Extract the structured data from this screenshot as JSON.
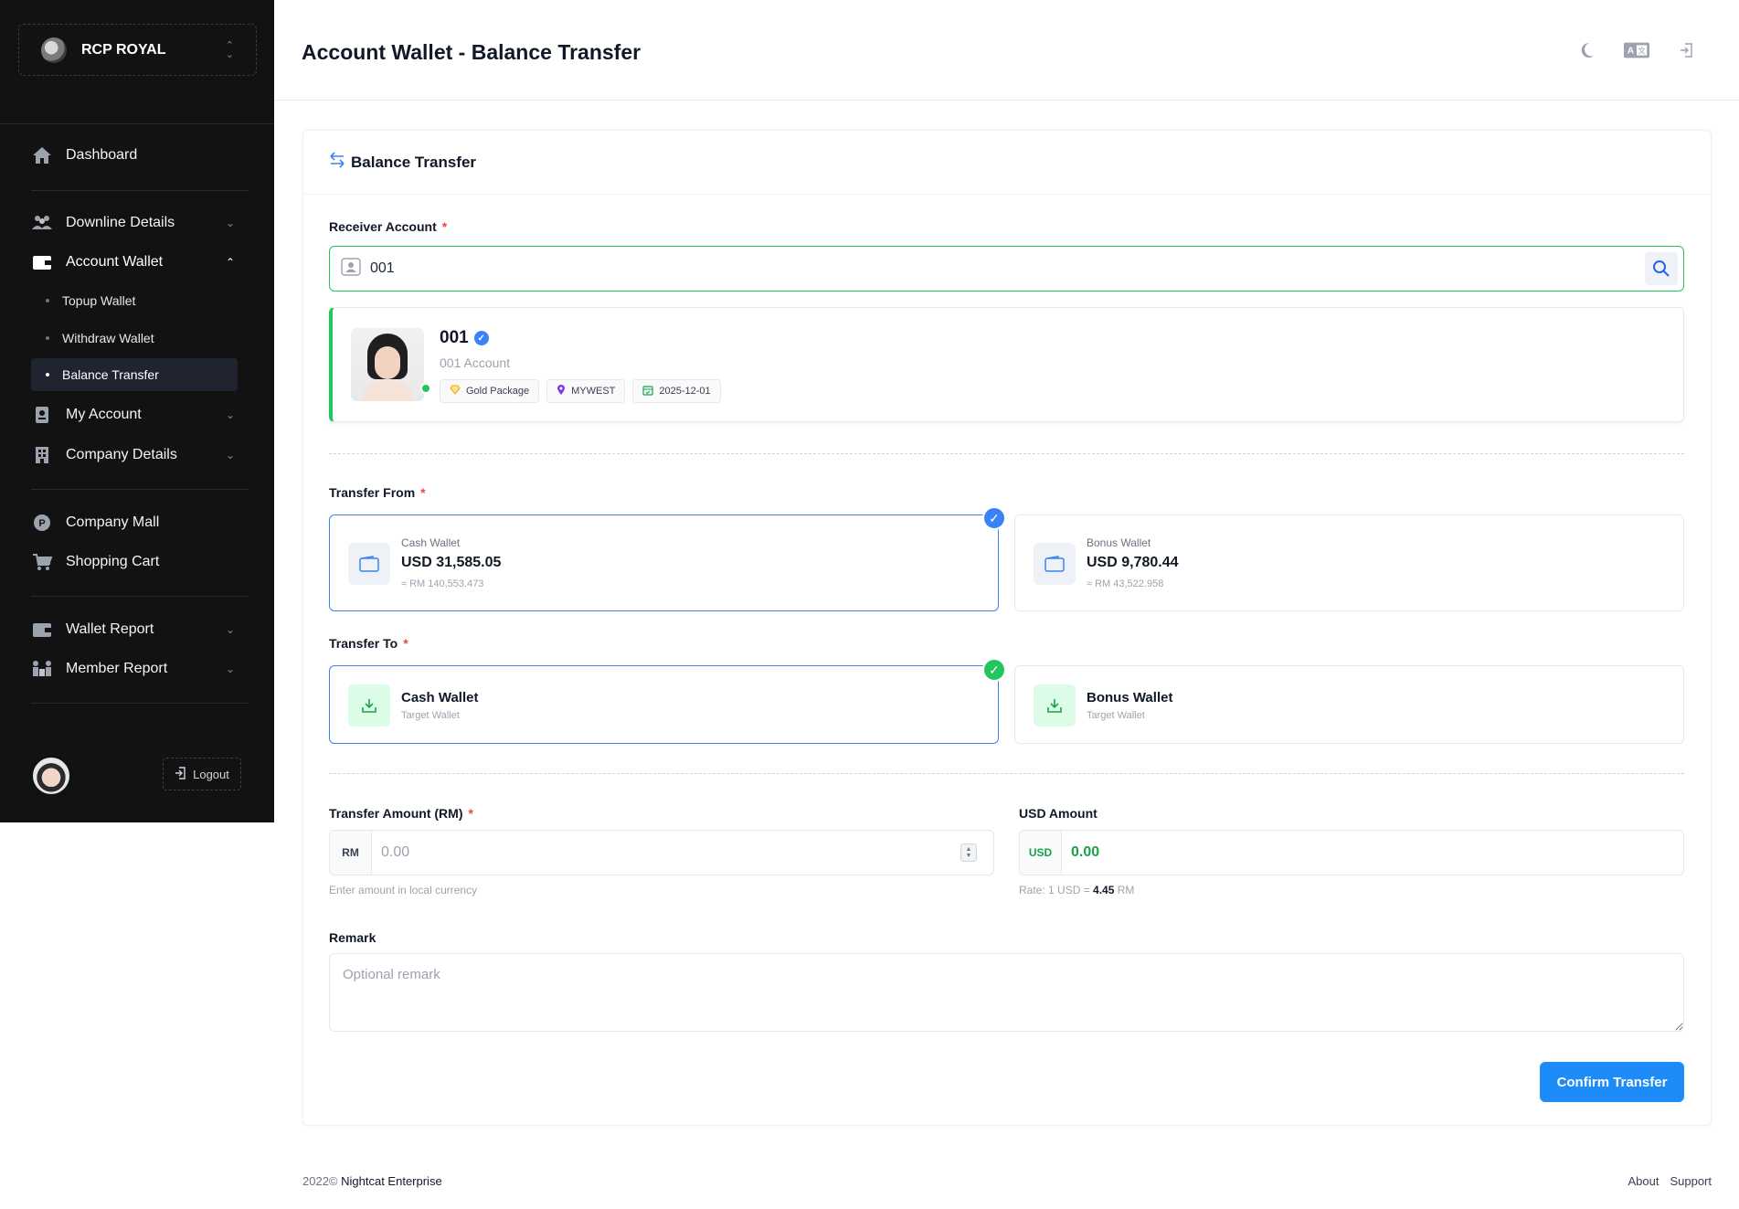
{
  "sidebar": {
    "brand": "RCP ROYAL",
    "items": [
      {
        "label": "Dashboard",
        "icon": "home-icon"
      },
      {
        "label": "Downline Details",
        "icon": "users-icon"
      },
      {
        "label": "Account Wallet",
        "icon": "wallet-icon"
      },
      {
        "label": "My Account",
        "icon": "id-badge-icon"
      },
      {
        "label": "Company Details",
        "icon": "building-icon"
      },
      {
        "label": "Company Mall",
        "icon": "mall-icon"
      },
      {
        "label": "Shopping Cart",
        "icon": "cart-icon"
      },
      {
        "label": "Wallet Report",
        "icon": "wallet-report-icon"
      },
      {
        "label": "Member Report",
        "icon": "member-report-icon"
      }
    ],
    "sub_items": [
      {
        "label": "Topup Wallet",
        "active": false
      },
      {
        "label": "Withdraw Wallet",
        "active": false
      },
      {
        "label": "Balance Transfer",
        "active": true
      }
    ],
    "logout": "Logout"
  },
  "header": {
    "title": "Account Wallet - Balance Transfer",
    "icons": [
      "moon-icon",
      "translate-icon",
      "signout-icon"
    ]
  },
  "card": {
    "title": "Balance Transfer"
  },
  "receiver": {
    "label": "Receiver Account",
    "value": "001",
    "account_id": "001",
    "account_name": "001 Account",
    "tags": [
      "Gold Package",
      "MYWEST",
      "2025-12-01"
    ]
  },
  "transfer_from": {
    "label": "Transfer From",
    "wallets": [
      {
        "name": "Cash Wallet",
        "amount": "USD 31,585.05",
        "local": "≈ RM 140,553.473",
        "selected": true
      },
      {
        "name": "Bonus Wallet",
        "amount": "USD 9,780.44",
        "local": "≈ RM 43,522.958",
        "selected": false
      }
    ]
  },
  "transfer_to": {
    "label": "Transfer To",
    "wallets": [
      {
        "name": "Cash Wallet",
        "sub": "Target Wallet",
        "selected": true
      },
      {
        "name": "Bonus Wallet",
        "sub": "Target Wallet",
        "selected": false
      }
    ]
  },
  "amount": {
    "label": "Transfer Amount (RM)",
    "prefix": "RM",
    "placeholder": "0.00",
    "hint": "Enter amount in local currency"
  },
  "usd": {
    "label": "USD Amount",
    "prefix": "USD",
    "value": "0.00",
    "rate_prefix": "Rate: 1 USD =",
    "rate_value": "4.45",
    "rate_suffix": "RM"
  },
  "remark": {
    "label": "Remark",
    "placeholder": "Optional remark"
  },
  "confirm": "Confirm Transfer",
  "footer": {
    "year": "2022©",
    "company": "Nightcat Enterprise",
    "links": [
      "About",
      "Support"
    ]
  },
  "colors": {
    "accent": "#1d8bf8",
    "success": "#22c55e",
    "sidebar_bg": "#121212"
  }
}
